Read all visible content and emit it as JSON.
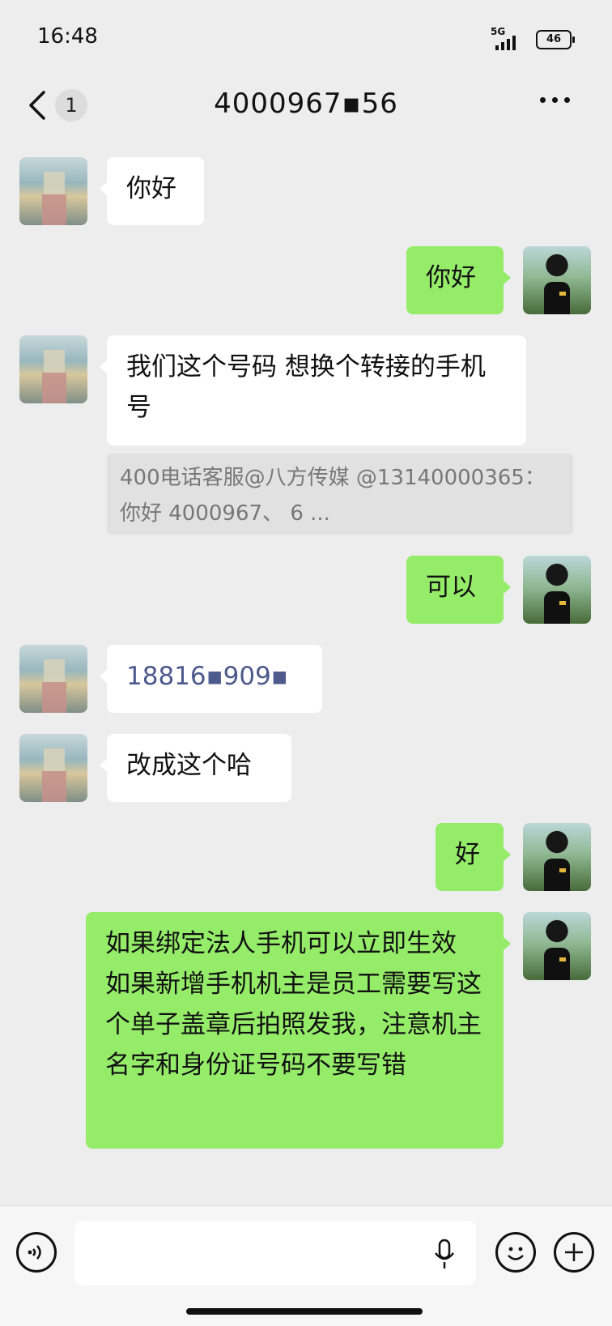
{
  "status_bar": {
    "time": "16:48",
    "network": "5G",
    "battery": "46"
  },
  "header": {
    "title": "4000967▪56",
    "unread_count": "1"
  },
  "messages": [
    {
      "side": "in",
      "text": "你好"
    },
    {
      "side": "out",
      "text": "你好"
    },
    {
      "side": "in",
      "text": "我们这个号码 想换个转接的手机号"
    },
    {
      "quote": "400电话客服@八方传媒 @13140000365：你好  4000967、 6 ..."
    },
    {
      "side": "out",
      "text": "可以"
    },
    {
      "side": "in",
      "text": "18816▪909▪"
    },
    {
      "side": "in",
      "text": "改成这个哈"
    },
    {
      "side": "out",
      "text": "好"
    },
    {
      "side": "out",
      "text": "如果绑定法人手机可以立即生效 如果新增手机机主是员工需要写这个单子盖章后拍照发我，注意机主名字和身份证号码不要写错"
    }
  ],
  "icons": {
    "voice": "voice-icon",
    "mic": "mic-icon",
    "emoji": "emoji-icon",
    "plus": "plus-icon"
  },
  "colors": {
    "bubble_out": "#95ec69",
    "bubble_in": "#ffffff",
    "background": "#ededed"
  }
}
